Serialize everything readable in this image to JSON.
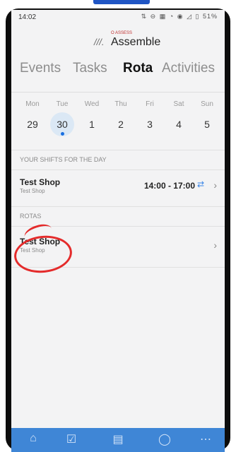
{
  "status_bar": {
    "time": "14:02",
    "icons": [
      "sync-icon",
      "minus-circle-icon",
      "nfc-icon",
      "wifi-icon",
      "location-icon",
      "signal-icon"
    ],
    "battery_text": "51%"
  },
  "app": {
    "logo_top": "O ASSESS",
    "logo_name": "Assemble"
  },
  "tabs": [
    {
      "label": "Events",
      "active": false
    },
    {
      "label": "Tasks",
      "active": false
    },
    {
      "label": "Rota",
      "active": true
    },
    {
      "label": "Activities",
      "active": false
    }
  ],
  "week": {
    "days": [
      {
        "dow": "Mon",
        "date": "29",
        "selected": false
      },
      {
        "dow": "Tue",
        "date": "30",
        "selected": true
      },
      {
        "dow": "Wed",
        "date": "1",
        "selected": false
      },
      {
        "dow": "Thu",
        "date": "2",
        "selected": false
      },
      {
        "dow": "Fri",
        "date": "3",
        "selected": false
      },
      {
        "dow": "Sat",
        "date": "4",
        "selected": false
      },
      {
        "dow": "Sun",
        "date": "5",
        "selected": false
      }
    ]
  },
  "shifts_section": {
    "label": "YOUR SHIFTS FOR THE DAY",
    "item": {
      "title": "Test Shop",
      "subtitle": "Test Shop",
      "time": "14:00 - 17:00"
    }
  },
  "rotas_section": {
    "label": "ROTAS",
    "item": {
      "title": "Test Shop",
      "subtitle": "Test Shop"
    }
  },
  "bottom_nav": {
    "icons": [
      "home-icon",
      "tasks-check-icon",
      "calendar-grid-icon",
      "chat-bubble-icon",
      "more-icon"
    ],
    "colors": {
      "nav_bg": "#3f86d6",
      "selected_date_bg": "#dbe8f5",
      "annotation": "#e42b2b",
      "accent": "#1a6fe0"
    }
  }
}
